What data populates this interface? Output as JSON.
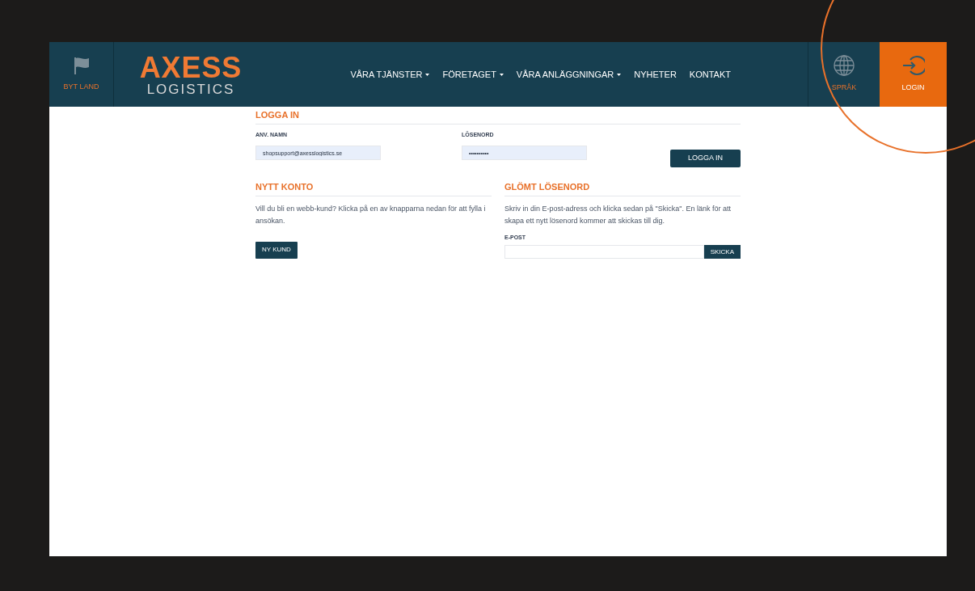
{
  "header": {
    "country": {
      "label": "BYT LAND"
    },
    "logo": {
      "top": "AXESS",
      "bottom": "LOGISTICS"
    },
    "nav": [
      {
        "label": "VÅRA TJÄNSTER",
        "dropdown": true
      },
      {
        "label": "FÖRETAGET",
        "dropdown": true
      },
      {
        "label": "VÅRA ANLÄGGNINGAR",
        "dropdown": true
      },
      {
        "label": "NYHETER",
        "dropdown": false
      },
      {
        "label": "KONTAKT",
        "dropdown": false
      }
    ],
    "language": {
      "label": "SPRÅK"
    },
    "login": {
      "label": "LOGIN",
      "selected": true
    }
  },
  "login": {
    "title": "LOGGA IN",
    "username": {
      "label": "ANV. NAMN",
      "value": "shopsupport@axesslogistics.se"
    },
    "password": {
      "label": "LÖSENORD",
      "value": "••••••••••"
    },
    "button": "LOGGA IN"
  },
  "new_account": {
    "title": "NYTT KONTO",
    "text": "Vill du bli en webb-kund? Klicka på en av knapparna nedan för att fylla i ansökan.",
    "button": "NY KUND"
  },
  "forgot": {
    "title": "GLÖMT LÖSENORD",
    "text": "Skriv in din E-post-adress och klicka sedan på \"Skicka\". En länk för att skapa ett nytt lösenord kommer att skickas till dig.",
    "email": {
      "label": "E-POST"
    },
    "button": "SKICKA"
  }
}
